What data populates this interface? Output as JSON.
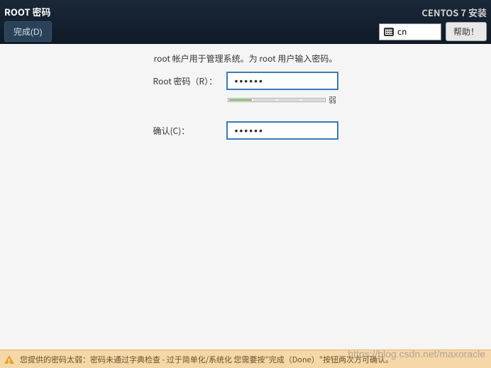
{
  "header": {
    "title": "ROOT 密码",
    "done_label": "完成(D)",
    "install_title": "CENTOS 7 安装",
    "help_label": "帮助！",
    "lang_code": "cn"
  },
  "form": {
    "description": "root 帐户用于管理系统。为 root 用户输入密码。",
    "root_label": "Root 密码（R）：",
    "root_value": "••••••",
    "confirm_label": "确认(C)：",
    "confirm_value": "••••••",
    "strength_label": "弱"
  },
  "warning": {
    "text": "您提供的密码太弱：密码未通过字典检查 - 过于简单化/系统化 您需要按\"完成（Done）\"按钮两次方可确认。"
  },
  "watermark": "https://blog.csdn.net/maxoracle"
}
